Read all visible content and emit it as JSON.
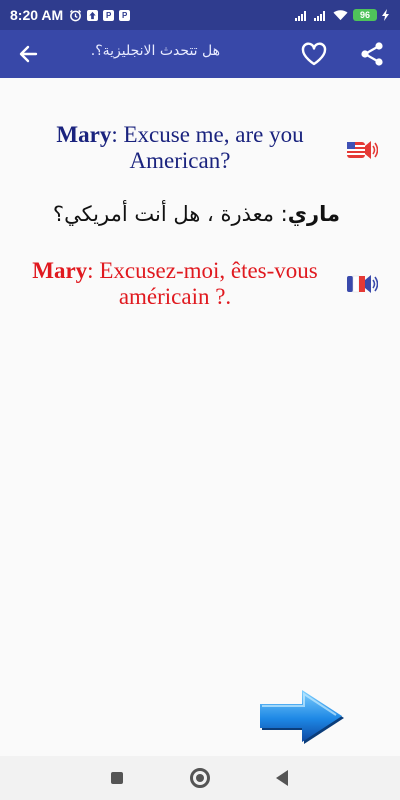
{
  "status_bar": {
    "time": "8:20 AM",
    "notification_icons": [
      "alarm-clock-icon",
      "upload-icon",
      "parking-icon",
      "parking-icon"
    ],
    "icon_letters": {
      "parking": "P"
    },
    "battery_level": "96"
  },
  "app_bar": {
    "title": "هل تتحدث الانجليزية؟.",
    "background": "#3848a8"
  },
  "content": {
    "english": {
      "speaker": "Mary",
      "separator": ": ",
      "text": "Excuse me, are you American?"
    },
    "arabic": {
      "speaker": "ماري",
      "separator": ": ",
      "text": "معذرة ، هل أنت أمريكي؟"
    },
    "french": {
      "speaker": "Mary",
      "separator": ": ",
      "text": "Excusez-moi, êtes-vous américain ?."
    }
  },
  "colors": {
    "english_text": "#1a237e",
    "french_text": "#e0191f",
    "status_bar": "#2f3c8e",
    "arrow_blue": "#1e88e5"
  },
  "icons": {
    "back": "arrow-left-icon",
    "favorite": "heart-outline-icon",
    "share": "share-icon",
    "speaker_english": "us-flag-speaker-icon",
    "speaker_french": "fr-flag-speaker-icon",
    "next": "next-arrow-icon"
  }
}
